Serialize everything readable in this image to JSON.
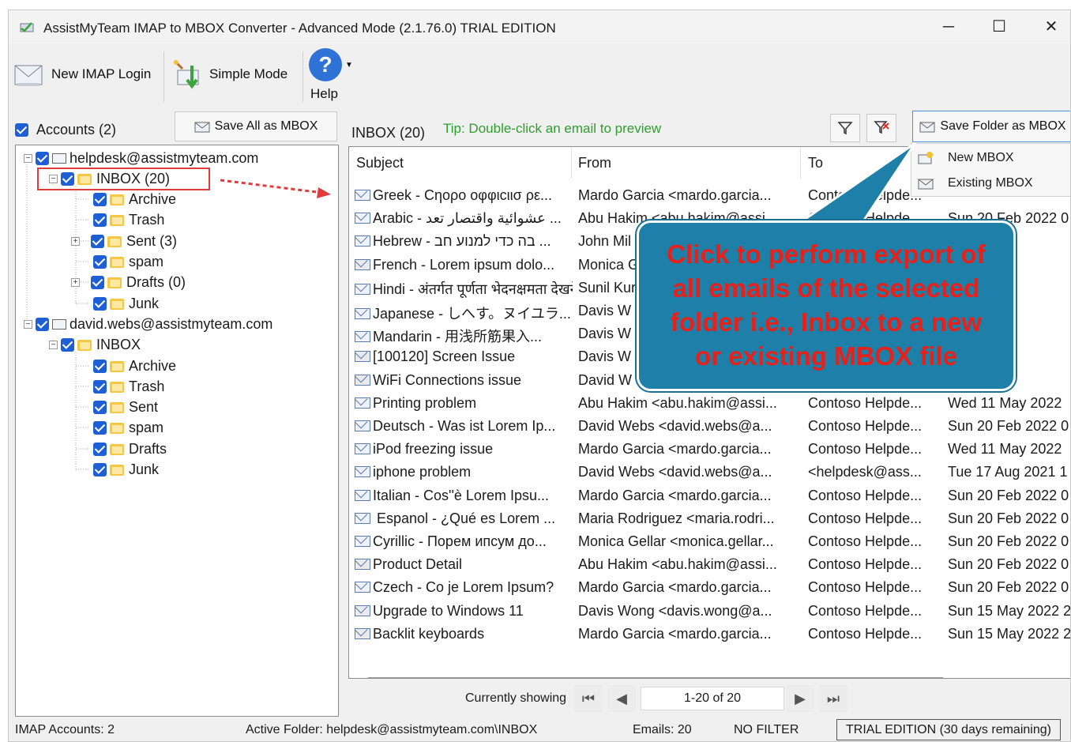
{
  "window": {
    "title": "AssistMyTeam IMAP to MBOX Converter - Advanced Mode (2.1.76.0) TRIAL EDITION",
    "minimize": "─",
    "maximize": "☐",
    "close": "✕"
  },
  "toolbar": {
    "new_login": "New IMAP Login",
    "simple_mode": "Simple Mode",
    "help_glyph": "?",
    "help": "Help"
  },
  "accounts": {
    "header": "Accounts (2)",
    "save_all": "Save All as MBOX"
  },
  "tree": [
    {
      "label": "helpdesk@assistmyteam.com",
      "kind": "account"
    },
    {
      "label": "INBOX (20)",
      "kind": "folder"
    },
    {
      "label": "Archive",
      "kind": "folder"
    },
    {
      "label": "Trash",
      "kind": "folder"
    },
    {
      "label": "Sent (3)",
      "kind": "folder"
    },
    {
      "label": "spam",
      "kind": "folder"
    },
    {
      "label": "Drafts (0)",
      "kind": "folder"
    },
    {
      "label": "Junk",
      "kind": "folder"
    },
    {
      "label": "david.webs@assistmyteam.com",
      "kind": "account"
    },
    {
      "label": "INBOX",
      "kind": "folder"
    },
    {
      "label": "Archive",
      "kind": "folder"
    },
    {
      "label": "Trash",
      "kind": "folder"
    },
    {
      "label": "Sent",
      "kind": "folder"
    },
    {
      "label": "spam",
      "kind": "folder"
    },
    {
      "label": "Drafts",
      "kind": "folder"
    },
    {
      "label": "Junk",
      "kind": "folder"
    }
  ],
  "mail": {
    "folder_title": "INBOX (20)",
    "tip": "Tip: Double-click an email to preview",
    "save_folder": "Save Folder as MBOX",
    "menu": [
      "New MBOX",
      "Existing MBOX"
    ],
    "columns": [
      "Subject",
      "From",
      "To"
    ],
    "rows": [
      {
        "subject": "Greek - Cηορο οφφιcιισ ρε...",
        "from": "Mardo Garcia <mardo.garcia...",
        "to": "Contoso Helpde...",
        "date": "",
        "att": false
      },
      {
        "subject": "Arabic - عشوائية واقتصار تعد ...",
        "from": "Abu Hakim <abu.hakim@assi...",
        "to": "Contoso Helpde...",
        "date": "Sun 20 Feb 2022 0",
        "att": false
      },
      {
        "subject": "Hebrew - בה כדי למנוע חב ...",
        "from": "John Mil",
        "to": "",
        "date": "2022 0",
        "att": false
      },
      {
        "subject": "French - Lorem ipsum dolo...",
        "from": "Monica G",
        "to": "",
        "date": "2022 0",
        "att": true
      },
      {
        "subject": "Hindi - अंतर्गत पूर्णता भेदनक्षमता देखने",
        "from": "Sunil Kur",
        "to": "",
        "date": "2022 0",
        "att": false
      },
      {
        "subject": "Japanese - しへす。ヌイユラ...",
        "from": "Davis W",
        "to": "",
        "date": "2022 0",
        "att": false
      },
      {
        "subject": "Mandarin - 用浅所筋果入...",
        "from": "Davis W",
        "to": "",
        "date": "2022 0",
        "att": false
      },
      {
        "subject": "[100120] Screen Issue",
        "from": "Davis W",
        "to": "",
        "date": "2022 21",
        "att": true
      },
      {
        "subject": "WiFi Connections issue",
        "from": "David W",
        "to": "",
        "date": "y 2022 2",
        "att": true
      },
      {
        "subject": "Printing problem",
        "from": "Abu Hakim <abu.hakim@assi...",
        "to": "Contoso Helpde...",
        "date": "Wed 11 May 2022",
        "att": false
      },
      {
        "subject": "Deutsch - Was ist Lorem Ip...",
        "from": "David Webs <david.webs@a...",
        "to": "Contoso Helpde...",
        "date": "Sun 20 Feb 2022 0",
        "att": false
      },
      {
        "subject": "iPod freezing issue",
        "from": "Mardo Garcia <mardo.garcia...",
        "to": "Contoso Helpde...",
        "date": "Wed 11 May 2022",
        "att": false
      },
      {
        "subject": "iphone problem",
        "from": "David Webs <david.webs@a...",
        "to": "<helpdesk@ass...",
        "date": "Tue 17 Aug 2021 1",
        "att": false
      },
      {
        "subject": "Italian - Cos''è Lorem Ipsu...",
        "from": "Mardo Garcia <mardo.garcia...",
        "to": "Contoso Helpde...",
        "date": "Sun 20 Feb 2022 0",
        "att": false
      },
      {
        "subject": " Espanol - ¿Qué es Lorem ...",
        "from": "Maria Rodriguez <maria.rodri...",
        "to": "Contoso Helpde...",
        "date": "Sun 20 Feb 2022 0",
        "att": false
      },
      {
        "subject": "Cyrillic - Порем ипсум до...",
        "from": "Monica Gellar <monica.gellar...",
        "to": "Contoso Helpde...",
        "date": "Sun 20 Feb 2022 0",
        "att": false
      },
      {
        "subject": "Product Detail",
        "from": "Abu Hakim <abu.hakim@assi...",
        "to": "Contoso Helpde...",
        "date": "Sun 20 Feb 2022 0",
        "att": true
      },
      {
        "subject": "Czech - Co je Lorem Ipsum?",
        "from": "Mardo Garcia <mardo.garcia...",
        "to": "Contoso Helpde...",
        "date": "Sun 20 Feb 2022 0",
        "att": false
      },
      {
        "subject": "Upgrade to Windows 11",
        "from": "Davis Wong <davis.wong@a...",
        "to": "Contoso Helpde...",
        "date": "Sun 15 May 2022 2",
        "att": true
      },
      {
        "subject": "Backlit keyboards",
        "from": "Mardo Garcia <mardo.garcia...",
        "to": "Contoso Helpde...",
        "date": "Sun 15 May 2022 2",
        "att": true
      }
    ]
  },
  "pager": {
    "label": "Currently showing",
    "range": "1-20 of 20",
    "first": "⏮",
    "prev": "◀",
    "next": "▶",
    "last": "⏭"
  },
  "status": {
    "accounts": "IMAP Accounts: 2",
    "active_folder": "Active Folder: helpdesk@assistmyteam.com\\INBOX",
    "emails": "Emails: 20",
    "filter": "NO FILTER",
    "trial": "TRIAL EDITION (30 days remaining)"
  },
  "callout": {
    "text": "Click to perform export of\nall emails of the selected\nfolder i.e., Inbox to a new\nor existing MBOX file"
  },
  "colors": {
    "accent_check": "#1f5fd6",
    "tip_green": "#2e9e2e",
    "callout_fill": "#1e7fa8",
    "callout_text": "#e8201a",
    "highlight_red": "#e03c3c"
  }
}
